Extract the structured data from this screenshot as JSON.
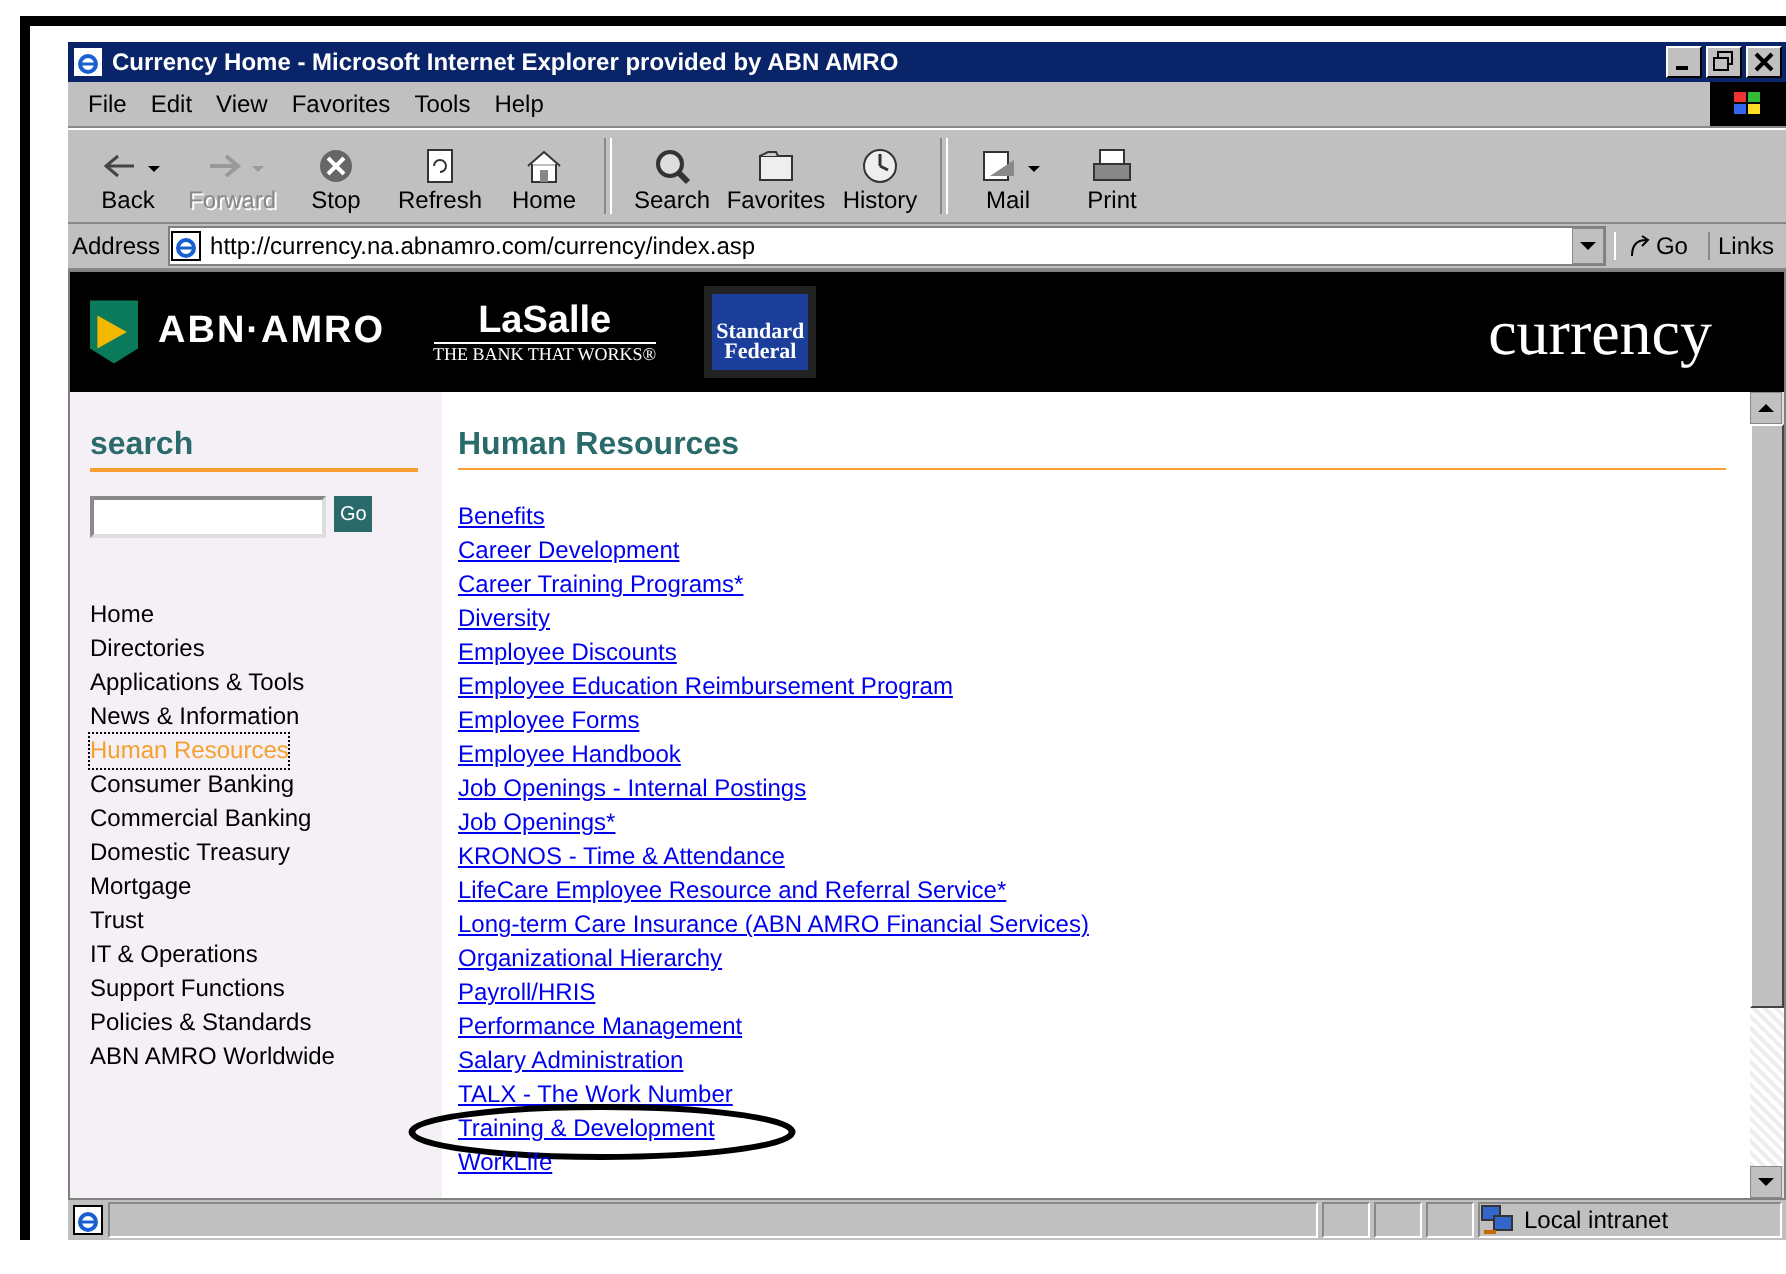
{
  "window": {
    "title": "Currency Home - Microsoft Internet Explorer provided by ABN AMRO"
  },
  "menu": [
    "File",
    "Edit",
    "View",
    "Favorites",
    "Tools",
    "Help"
  ],
  "toolbar": [
    {
      "kind": "back",
      "label": "Back",
      "disabled": false,
      "dropdown": true
    },
    {
      "kind": "forward",
      "label": "Forward",
      "disabled": true,
      "dropdown": true
    },
    {
      "kind": "stop",
      "label": "Stop",
      "disabled": false,
      "dropdown": false
    },
    {
      "kind": "refresh",
      "label": "Refresh",
      "disabled": false,
      "dropdown": false
    },
    {
      "kind": "home",
      "label": "Home",
      "disabled": false,
      "dropdown": false
    },
    {
      "kind": "search",
      "label": "Search",
      "disabled": false,
      "dropdown": false
    },
    {
      "kind": "favorites",
      "label": "Favorites",
      "disabled": false,
      "dropdown": false
    },
    {
      "kind": "history",
      "label": "History",
      "disabled": false,
      "dropdown": false
    },
    {
      "kind": "mail",
      "label": "Mail",
      "disabled": false,
      "dropdown": true
    },
    {
      "kind": "print",
      "label": "Print",
      "disabled": false,
      "dropdown": false
    }
  ],
  "address_bar": {
    "label": "Address",
    "value": "http://currency.na.abnamro.com/currency/index.asp",
    "go": "Go",
    "links": "Links"
  },
  "banner": {
    "abn": "ABN·AMRO",
    "lasalle": "LaSalle",
    "lasalle_tagline": "THE BANK THAT WORKS®",
    "standard_federal": [
      "Standard",
      "Federal"
    ],
    "site": "currency"
  },
  "sidebar": {
    "search_heading": "search",
    "search_button": "Go",
    "items": [
      {
        "label": "Home",
        "selected": false
      },
      {
        "label": "Directories",
        "selected": false
      },
      {
        "label": "Applications & Tools",
        "selected": false
      },
      {
        "label": "News & Information",
        "selected": false
      },
      {
        "label": "Human Resources",
        "selected": true
      },
      {
        "label": "Consumer Banking",
        "selected": false
      },
      {
        "label": "Commercial Banking",
        "selected": false
      },
      {
        "label": "Domestic Treasury",
        "selected": false
      },
      {
        "label": "Mortgage",
        "selected": false
      },
      {
        "label": "Trust",
        "selected": false
      },
      {
        "label": "IT & Operations",
        "selected": false
      },
      {
        "label": "Support Functions",
        "selected": false
      },
      {
        "label": "Policies & Standards",
        "selected": false
      },
      {
        "label": "ABN AMRO Worldwide",
        "selected": false
      }
    ]
  },
  "content": {
    "heading": "Human Resources",
    "links": [
      {
        "label": "Benefits",
        "circled": false
      },
      {
        "label": "Career Development",
        "circled": false
      },
      {
        "label": "Career Training Programs*",
        "circled": false
      },
      {
        "label": "Diversity",
        "circled": false
      },
      {
        "label": "Employee Discounts",
        "circled": false
      },
      {
        "label": "Employee Education Reimbursement Program",
        "circled": false
      },
      {
        "label": "Employee Forms",
        "circled": false
      },
      {
        "label": "Employee Handbook",
        "circled": false
      },
      {
        "label": "Job Openings - Internal Postings",
        "circled": false
      },
      {
        "label": "Job Openings*",
        "circled": false
      },
      {
        "label": "KRONOS - Time & Attendance",
        "circled": false
      },
      {
        "label": "LifeCare Employee Resource and Referral Service*",
        "circled": false
      },
      {
        "label": "Long-term Care Insurance (ABN AMRO Financial Services)",
        "circled": false
      },
      {
        "label": "Organizational Hierarchy",
        "circled": false
      },
      {
        "label": "Payroll/HRIS",
        "circled": false
      },
      {
        "label": "Performance Management",
        "circled": false
      },
      {
        "label": "Salary Administration",
        "circled": false
      },
      {
        "label": "TALX - The Work Number",
        "circled": false
      },
      {
        "label": "Training & Development",
        "circled": true
      },
      {
        "label": "WorkLife",
        "circled": false
      }
    ]
  },
  "status_bar": {
    "zone": "Local intranet"
  }
}
